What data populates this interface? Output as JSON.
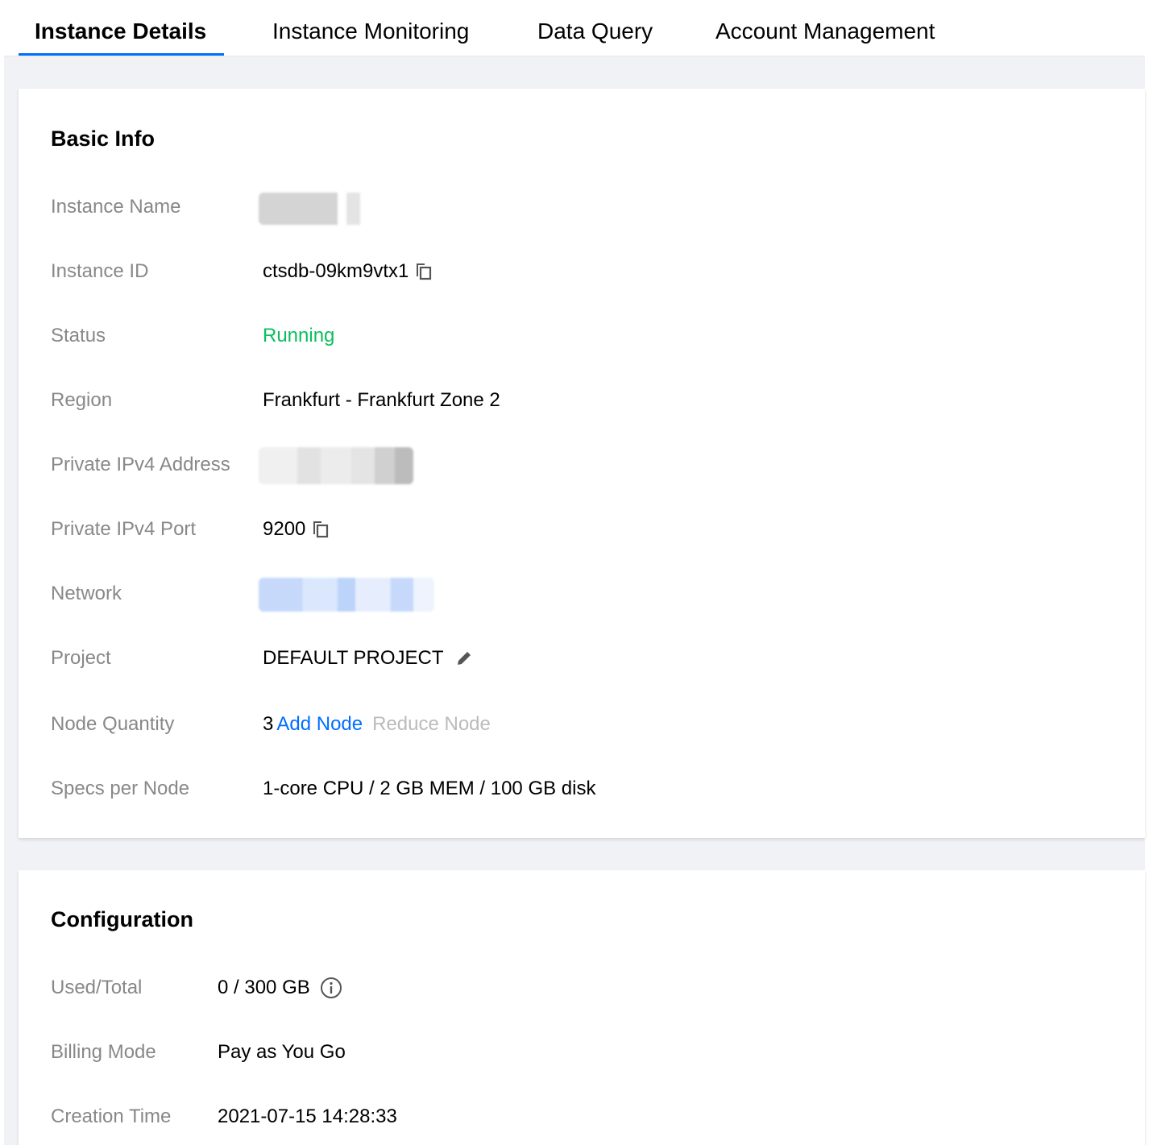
{
  "tabs": [
    {
      "label": "Instance Details",
      "active": true
    },
    {
      "label": "Instance Monitoring",
      "active": false
    },
    {
      "label": "Data Query",
      "active": false
    },
    {
      "label": "Account Management",
      "active": false
    }
  ],
  "basic_info": {
    "title": "Basic Info",
    "instance_name": {
      "label": "Instance Name"
    },
    "instance_id": {
      "label": "Instance ID",
      "value": "ctsdb-09km9vtx1",
      "icon": "copy-icon"
    },
    "status": {
      "label": "Status",
      "value": "Running",
      "color": "#0abf5b"
    },
    "region": {
      "label": "Region",
      "value": "Frankfurt - Frankfurt Zone 2"
    },
    "private_ipv4_address": {
      "label": "Private IPv4 Address"
    },
    "private_ipv4_port": {
      "label": "Private IPv4 Port",
      "value": "9200",
      "icon": "copy-icon"
    },
    "network": {
      "label": "Network"
    },
    "project": {
      "label": "Project",
      "value": "DEFAULT PROJECT",
      "icon": "pencil-icon"
    },
    "node_quantity": {
      "label": "Node Quantity",
      "value": "3",
      "add_label": "Add Node",
      "reduce_label": "Reduce Node"
    },
    "specs_per_node": {
      "label": "Specs per Node",
      "value": "1-core CPU / 2 GB MEM / 100 GB disk"
    }
  },
  "configuration": {
    "title": "Configuration",
    "used_total": {
      "label": "Used/Total",
      "value": "0 / 300 GB",
      "icon": "info-icon"
    },
    "billing_mode": {
      "label": "Billing Mode",
      "value": "Pay as You Go"
    },
    "creation_time": {
      "label": "Creation Time",
      "value": "2021-07-15 14:28:33"
    }
  },
  "colors": {
    "accent": "#006eff",
    "label": "#888888",
    "running": "#0abf5b"
  }
}
